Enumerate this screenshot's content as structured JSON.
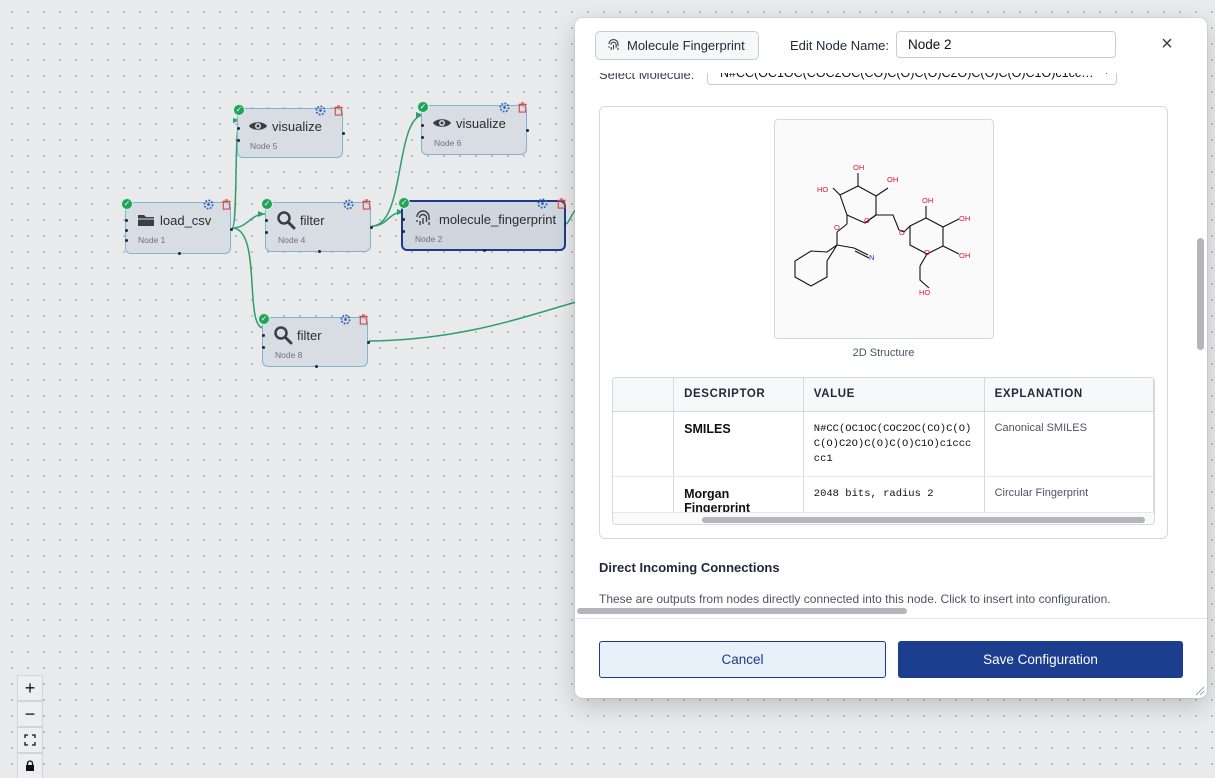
{
  "canvas": {
    "nodes": [
      {
        "id": "node1",
        "label": "load_csv",
        "sub": "Node 1",
        "icon": "folder-icon"
      },
      {
        "id": "node5",
        "label": "visualize",
        "sub": "Node 5",
        "icon": "eye-icon"
      },
      {
        "id": "node4",
        "label": "filter",
        "sub": "Node 4",
        "icon": "magnifier-icon"
      },
      {
        "id": "node6",
        "label": "visualize",
        "sub": "Node 6",
        "icon": "eye-icon"
      },
      {
        "id": "node2",
        "label": "molecule_fingerprint",
        "sub": "Node 2",
        "icon": "fingerprint-icon"
      },
      {
        "id": "node8",
        "label": "filter",
        "sub": "Node 8",
        "icon": "magnifier-icon"
      }
    ],
    "zoom_controls": {
      "zoom_in": "+",
      "zoom_out": "−"
    }
  },
  "modal": {
    "node_type": "Molecule Fingerprint",
    "edit_label": "Edit Node Name:",
    "node_name": "Node 2",
    "close": "×",
    "select_label": "Select Molecule:",
    "select_value": "N#CC(OC1OC(COC2OC(CO)C(O)C(O)C2O)C(O)C(O)C1O)c1cccc...",
    "structure_caption": "2D Structure",
    "molecule_labels": {
      "oh": "OH",
      "ho": "HO",
      "o": "O",
      "n": "N"
    },
    "table": {
      "headers": [
        "",
        "DESCRIPTOR",
        "VALUE",
        "EXPLANATION"
      ],
      "rows": [
        {
          "descriptor": "SMILES",
          "value": "N#CC(OC1OC(COC2OC(CO)C(O)C(O)C2O)C(O)C(O)C1O)c1ccccc1",
          "explanation": "Canonical SMILES"
        },
        {
          "descriptor": "Morgan Fingerprint",
          "value": "2048 bits, radius 2",
          "explanation": "Circular Fingerprint"
        }
      ]
    },
    "section_title": "Direct Incoming Connections",
    "section_desc": "These are outputs from nodes directly connected into this node. Click to insert into configuration.",
    "cancel_label": "Cancel",
    "save_label": "Save Configuration"
  },
  "colors": {
    "edge": "#2e9e6b",
    "accent": "#1b3e8f",
    "status_ok": "#22a35a",
    "delete": "#d9463e",
    "gear": "#2b5fb8",
    "oxygen": "#e0162b",
    "nitrogen": "#1f2bd6"
  }
}
